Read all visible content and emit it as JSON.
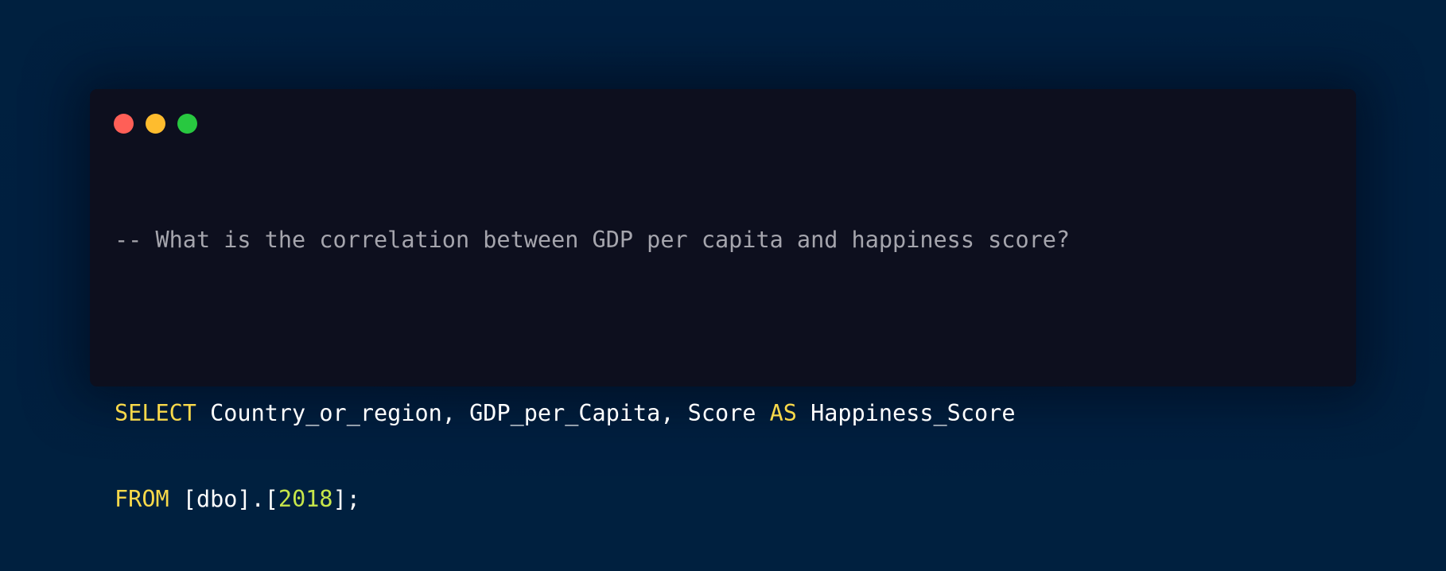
{
  "window": {
    "traffic_lights": [
      {
        "name": "close",
        "color": "#ff5f57"
      },
      {
        "name": "minimize",
        "color": "#febc2e"
      },
      {
        "name": "maximize",
        "color": "#28c840"
      }
    ]
  },
  "code": {
    "comment": "-- What is the correlation between GDP per capita and happiness score?",
    "line1": {
      "kw_select": "SELECT",
      "columns": " Country_or_region, GDP_per_Capita, Score ",
      "kw_as": "AS",
      "alias": " Happiness_Score"
    },
    "line2": {
      "kw_from": "FROM",
      "table_prefix": " [dbo].[",
      "table_number": "2018",
      "table_suffix": "];"
    }
  }
}
